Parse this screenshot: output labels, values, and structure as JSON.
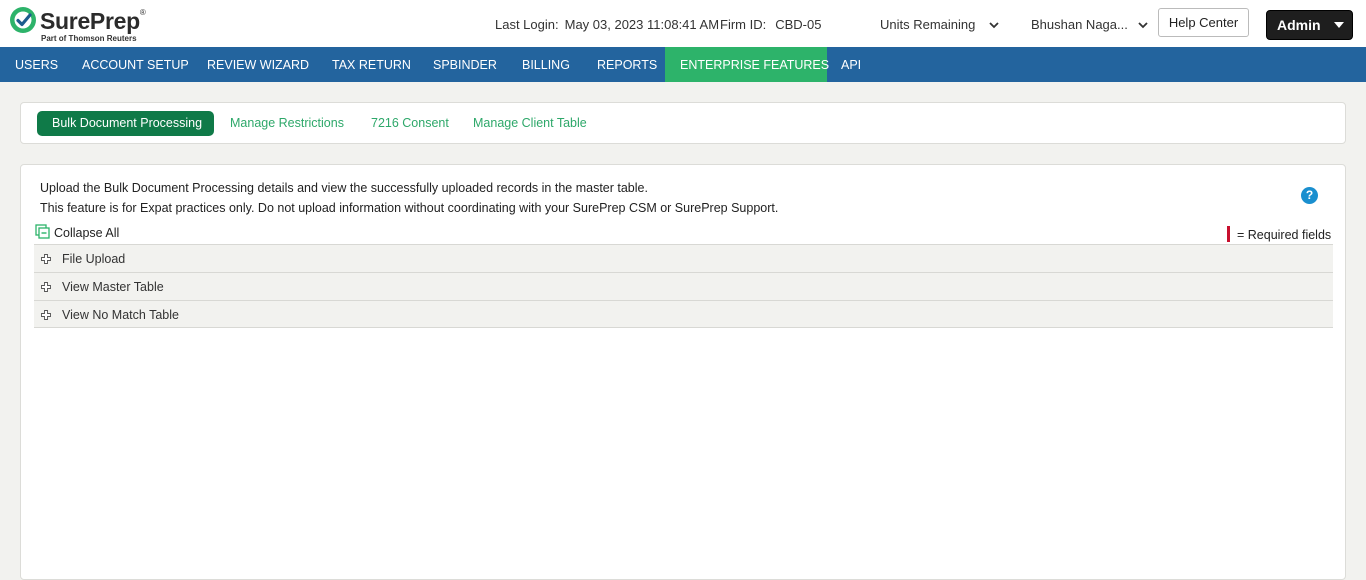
{
  "header": {
    "logo_brand": "SurePrep",
    "logo_registered": "®",
    "logo_sub": "Part of Thomson Reuters",
    "last_login_label": "Last Login:",
    "last_login_value": "May 03, 2023 11:08:41 AM",
    "firm_label": "Firm ID:",
    "firm_value": "CBD-05",
    "units_label": "Units Remaining",
    "user_name": "Bhushan Naga...",
    "help_center": "Help Center",
    "role": "Admin"
  },
  "nav": {
    "items": [
      "USERS",
      "ACCOUNT SETUP",
      "REVIEW WIZARD",
      "TAX RETURN",
      "SPBINDER",
      "BILLING",
      "REPORTS",
      "ENTERPRISE FEATURES",
      "API"
    ],
    "active": "ENTERPRISE FEATURES"
  },
  "subtabs": {
    "items": [
      "Bulk Document Processing",
      "Manage Restrictions",
      "7216 Consent",
      "Manage Client Table"
    ],
    "active": "Bulk Document Processing"
  },
  "main": {
    "desc_line1": "Upload the Bulk Document Processing details and view the successfully uploaded records in the master table.",
    "desc_line2": "This feature is for Expat practices only. Do not upload information without coordinating with your SurePrep CSM or SurePrep Support.",
    "help_icon": "?",
    "collapse_all": "Collapse All",
    "required_fields": "= Required fields",
    "sections": [
      "File Upload",
      "View Master Table",
      "View No Match Table"
    ]
  },
  "colors": {
    "nav_bg": "#23649e",
    "nav_active": "#2db36a",
    "subtab_active": "#0f7a48",
    "subtab_link": "#2ea86a",
    "required_marker": "#c8102e",
    "help_icon": "#1a8fcf"
  }
}
